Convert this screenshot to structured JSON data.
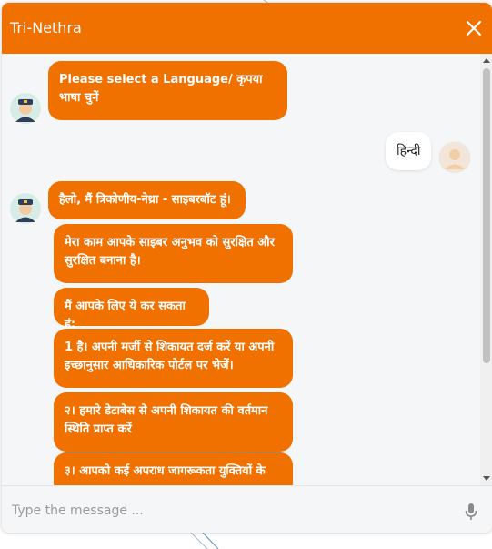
{
  "header": {
    "title": "Tri-Nethra"
  },
  "messages": {
    "bot_greeting": "Please select a Language/ कृपया भाषा चुनें",
    "user_choice": "हिन्दी",
    "bot_hello": "हैलो, मैं त्रिकोणीय-नेथ्रा - साइबरबॉट हूं।",
    "bot_intro": "मेरा काम आपके साइबर अनुभव को सुरक्षित और सुरक्षित बनाना है।",
    "bot_can_do": "मैं आपके लिए ये कर सकता हूं:",
    "option_1": "1 है। अपनी मर्जी से शिकायत दर्ज करें या अपनी इच्छानुसार आधिकारिक पोर्टल पर भेजें।",
    "option_2": "२। हमारे डेटाबेस से अपनी शिकायत की वर्तमान स्थिति प्राप्त करें",
    "option_3": "३। आपको कई अपराध जागरूकता युक्तियों के"
  },
  "input": {
    "placeholder": "Type the message ..."
  },
  "icons": {
    "close": "close-icon",
    "bot_avatar": "police-officer-avatar-icon",
    "user_avatar": "user-avatar-icon",
    "mic": "microphone-icon"
  },
  "colors": {
    "accent": "#f07000",
    "background": "#f5f6f8"
  }
}
